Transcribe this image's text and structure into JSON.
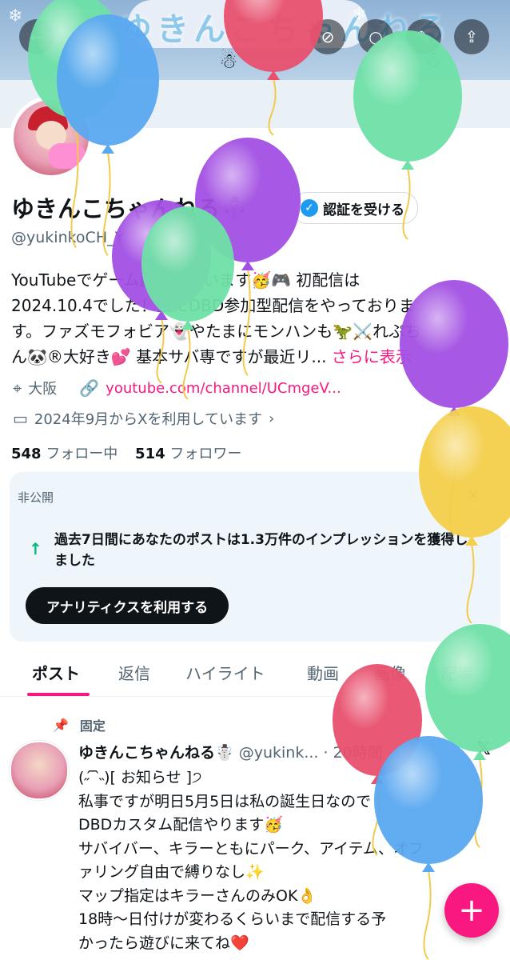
{
  "banner": {
    "title": "ゆきんこちゃんねる"
  },
  "top_actions": [
    {
      "icon": "back-arrow-icon",
      "glyph": "←"
    },
    {
      "icon": "slash-circle-icon",
      "glyph": "⊘"
    },
    {
      "icon": "search-icon",
      "glyph": "○"
    },
    {
      "icon": "pen-icon",
      "glyph": "✎"
    },
    {
      "icon": "share-icon",
      "glyph": "⇪"
    }
  ],
  "profile": {
    "name": "ゆきんこちゃんねる☃️",
    "verify_label": "認証を受ける",
    "handle": "@yukinkoCH_Y",
    "bio_lines": [
      "YouTubeでゲーム配信しています🥳🎮 初配信は",
      "2024.10.4でした！主にDBD参加型配信をやっておりま",
      "す。ファズモフォビア👻やたまにモンハンも🦖⚔️れぷち",
      "ん🐼®大好き💕 基本サバ専ですが最近リ..."
    ],
    "more": "さらに表示",
    "location": "大阪",
    "url": "youtube.com/channel/UCmgeV...",
    "joined": "2024年9月からXを利用しています",
    "following_count": "548",
    "following_label": "フォロー中",
    "followers_count": "514",
    "followers_label": "フォロワー"
  },
  "analytics_card": {
    "label": "非公開",
    "text": "過去7日間にあなたのポストは1.3万件のインプレッションを獲得しました",
    "button": "アナリティクスを利用する"
  },
  "tabs": [
    "ポスト",
    "返信",
    "ハイライト",
    "動画",
    "画像",
    "記事"
  ],
  "post": {
    "pinned_label": "固定",
    "author": "ゆきんこちゃんねる☃️",
    "handle_time": "@yukink... · 20時間",
    "lines": [
      "(˶ ᷇ ᷆˵)[ お知らせ ]੭",
      "私事ですが明日5月5日は私の誕生日なので",
      "DBDカスタム配信やります🥳",
      "サバイバー、キラーともにパーク、アイテム、オフ",
      "ァリング自由で縛りなし✨",
      "マップ指定はキラーさんのみOK👌",
      "18時〜日付けが変わるくらいまで配信する予",
      "かったら遊びに来てね❤️"
    ]
  },
  "colors": {
    "accent": "#f91880",
    "verified": "#1d9bf0",
    "balloon_green": "#6fe0a6",
    "balloon_blue": "#5aa8f0",
    "balloon_purple": "#a24fe3",
    "balloon_red": "#e8506e",
    "balloon_yellow": "#f3cf4a"
  }
}
